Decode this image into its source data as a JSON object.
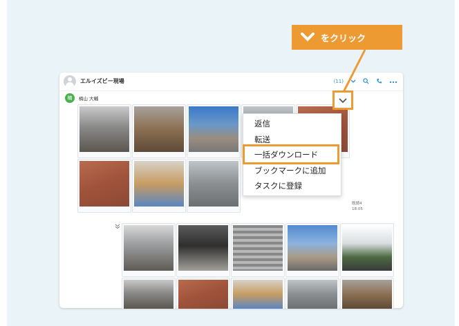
{
  "app": {
    "chat_title": "エルイズビー現場",
    "member_count": "(11)",
    "sender_initial": "楠",
    "sender_name": "楠山 大輔"
  },
  "context_menu": {
    "items": [
      "返信",
      "転送",
      "一括ダウンロード",
      "ブックマークに追加",
      "タスクに登録"
    ],
    "highlighted_index": 2
  },
  "callout": {
    "label": "をクリック",
    "icon": "chevron-down-icon"
  },
  "message": {
    "status": "既読4",
    "time": "18:05"
  },
  "icons": {
    "header": [
      "chevron-down-icon",
      "search-icon",
      "phone-icon",
      "more-icon"
    ],
    "collapse": "double-chevron-down-icon"
  },
  "colors": {
    "accent": "#ee9a33",
    "link": "#2b8fd6",
    "avatar": "#4caf50",
    "background": "#eaf3f8"
  }
}
